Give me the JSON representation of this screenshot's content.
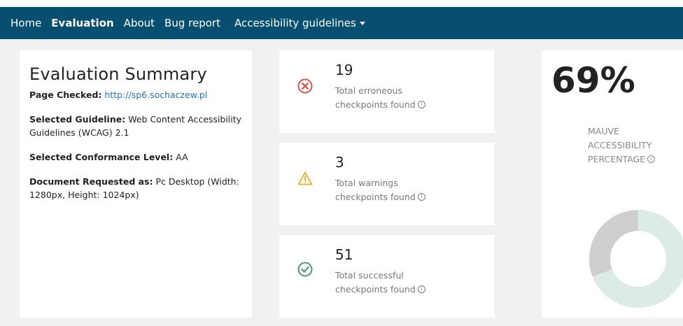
{
  "navbar": {
    "links": [
      {
        "label": "Home",
        "active": false
      },
      {
        "label": "Evaluation",
        "active": true
      },
      {
        "label": "About",
        "active": false
      },
      {
        "label": "Bug report",
        "active": false
      }
    ],
    "dropdown_label": "Accessibility guidelines",
    "background_color": "#064f70"
  },
  "summary": {
    "title": "Evaluation Summary",
    "page_checked_label": "Page Checked:",
    "page_checked_url": "http://sp6.sochaczew.pl",
    "guideline_label": "Selected Guideline:",
    "guideline_value": "Web Content Accessibility Guidelines (WCAG) 2.1",
    "conformance_label": "Selected Conformance Level:",
    "conformance_value": "AA",
    "document_label": "Document Requested as:",
    "document_value": "Pc Desktop (Width: 1280px, Height: 1024px)"
  },
  "stats": {
    "errors": {
      "count": "19",
      "text": "Total erroneous checkpoints found",
      "icon": "error-x-circle-icon",
      "color": "#d9534f"
    },
    "warnings": {
      "count": "3",
      "text": "Total warnings checkpoints found",
      "icon": "warning-triangle-icon",
      "color": "#f0ad1e"
    },
    "successes": {
      "count": "51",
      "text": "Total successful checkpoints found",
      "icon": "check-circle-icon",
      "color": "#4a9a6a"
    }
  },
  "score": {
    "percentage_text": "69%",
    "label": "MAUVE ACCESSIBILITY PERCENTAGE",
    "percentage_value": 69,
    "colors": {
      "achieved": "#dcebe6",
      "remaining": "#cfcfcf"
    }
  }
}
